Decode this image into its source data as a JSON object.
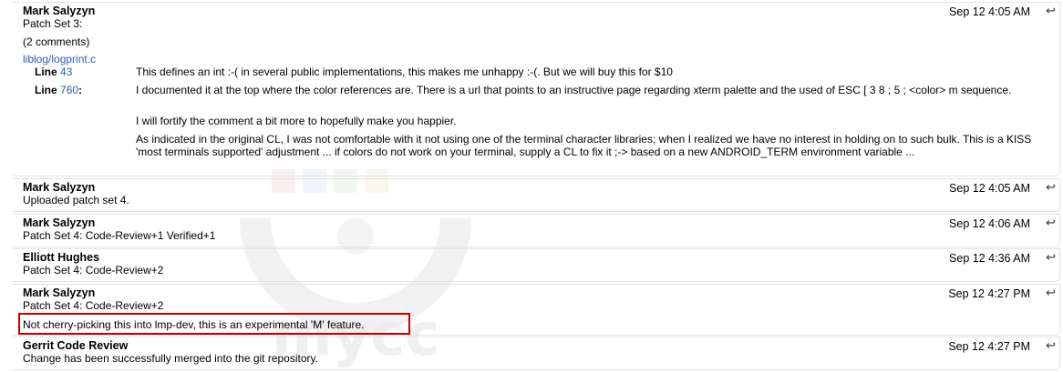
{
  "messages": [
    {
      "author": "Mark Salyzyn",
      "date": "Sep 12 4:05 AM",
      "lines": [
        "Patch Set 3:",
        "(2 comments)"
      ],
      "file_link": "liblog/logprint.c",
      "comments": [
        {
          "label_prefix": "Line",
          "line_number": "43",
          "texts": [
            "This defines an int :-( in several public implementations, this makes me unhappy :-(. But we will buy this for $10"
          ]
        },
        {
          "label_prefix": "Line",
          "line_number": "760",
          "texts": [
            "I documented it at the top where the color references are. There is a url that points to an instructive page regarding xterm palette and the used of ESC [ 3 8 ; 5 ; <color> m sequence.",
            "I will fortify the comment a bit more to hopefully make you happier.",
            "As indicated in the original CL, I was not comfortable with it not using one of the terminal character libraries; when I realized we have no interest in holding on to such bulk. This is a KISS 'most terminals supported' adjustment ... if colors do not work on your terminal, supply a CL to fix it ;-> based on a new ANDROID_TERM environment variable ..."
          ]
        }
      ]
    },
    {
      "author": "Mark Salyzyn",
      "date": "Sep 12 4:05 AM",
      "lines": [
        "Uploaded patch set 4."
      ]
    },
    {
      "author": "Mark Salyzyn",
      "date": "Sep 12 4:06 AM",
      "lines": [
        "Patch Set 4: Code-Review+1 Verified+1"
      ]
    },
    {
      "author": "Elliott Hughes",
      "date": "Sep 12 4:36 AM",
      "lines": [
        "Patch Set 4: Code-Review+2"
      ]
    },
    {
      "author": "Mark Salyzyn",
      "date": "Sep 12 4:27 PM",
      "lines": [
        "Patch Set 4: Code-Review+2",
        "Not cherry-picking this into lmp-dev, this is an experimental 'M' feature."
      ]
    },
    {
      "author": "Gerrit Code Review",
      "date": "Sep 12 4:27 PM",
      "lines": [
        "Change has been successfully merged into the git repository."
      ]
    }
  ],
  "reply_glyph": "↩",
  "icons": {
    "reply": "reply-arrow-icon",
    "watermark": "watermark-logo"
  },
  "colors": {
    "link": "#2a5db0",
    "highlight_border": "#cc0000",
    "divider": "#e3e3e3"
  }
}
